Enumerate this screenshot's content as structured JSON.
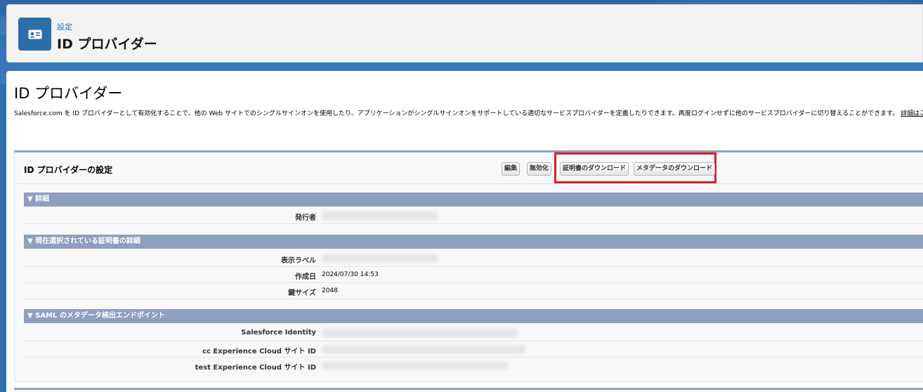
{
  "header": {
    "crumb": "設定",
    "title": "ID プロバイダー",
    "icon": "id-card-icon"
  },
  "page": {
    "heading": "ID プロバイダー",
    "description": "Salesforce.com を ID プロバイダーとして有効化することで、他の Web サイトでのシングルサインオンを使用したり、アプリケーションがシングルサインオンをサポートしている適切なサービスプロバイダーを定義したりできます。再度ログインせずに他のサービスプロバイダーに切り替えることができます。",
    "more_link": "詳細はこちら..."
  },
  "panel": {
    "title": "ID プロバイダーの設定",
    "buttons": {
      "edit": "編集",
      "disable": "無効化",
      "download_cert": "証明書のダウンロード",
      "download_metadata": "メタデータのダウンロード"
    }
  },
  "sections": {
    "details": {
      "title": "▼ 詳細",
      "issuer_label": "発行者"
    },
    "certificate": {
      "title": "▼ 現在選択されている証明書の詳細",
      "label_label": "表示ラベル",
      "created_label": "作成日",
      "created_value": "2024/07/30 14:53",
      "keysize_label": "鍵サイズ",
      "keysize_value": "2048"
    },
    "saml": {
      "title": "▼ SAML のメタデータ検出エンドポイント",
      "row1_label": "Salesforce Identity",
      "row2_label": "cc Experience Cloud サイト ID",
      "row3_label": "test Experience Cloud サイト ID"
    }
  },
  "colors": {
    "brand": "#2b6ea8",
    "section_bar": "#8e9fbf",
    "highlight": "#d6202b"
  }
}
